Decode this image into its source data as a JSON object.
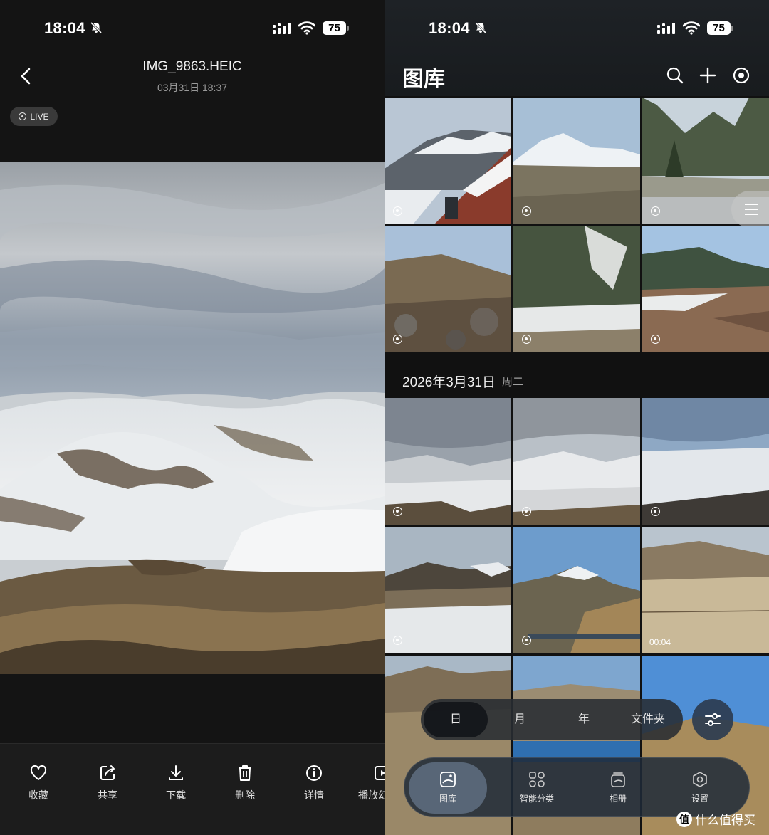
{
  "status_bar": {
    "time": "18:04",
    "battery": "75"
  },
  "viewer": {
    "file_name": "IMG_9863.HEIC",
    "timestamp": "03月31日 18:37",
    "live_badge": "LIVE",
    "actions": [
      {
        "label": "收藏",
        "icon": "heart-icon"
      },
      {
        "label": "共享",
        "icon": "share-icon"
      },
      {
        "label": "下载",
        "icon": "download-icon"
      },
      {
        "label": "删除",
        "icon": "trash-icon"
      },
      {
        "label": "详情",
        "icon": "info-icon"
      },
      {
        "label": "播放幻",
        "icon": "slideshow-icon"
      }
    ]
  },
  "library": {
    "title": "图库",
    "header_icons": [
      "search-icon",
      "plus-icon",
      "record-icon"
    ],
    "date_header": "2026年3月31日",
    "weekday": "周二",
    "video_duration": "00:04",
    "view_modes": [
      "日",
      "月",
      "年",
      "文件夹"
    ],
    "active_view_mode": "日",
    "nav": [
      {
        "label": "图库",
        "icon": "gallery-icon"
      },
      {
        "label": "智能分类",
        "icon": "categories-icon"
      },
      {
        "label": "相册",
        "icon": "album-icon"
      },
      {
        "label": "设置",
        "icon": "settings-icon"
      }
    ],
    "active_nav": "图库"
  },
  "watermark": {
    "text": "什么值得买",
    "badge": "值"
  }
}
